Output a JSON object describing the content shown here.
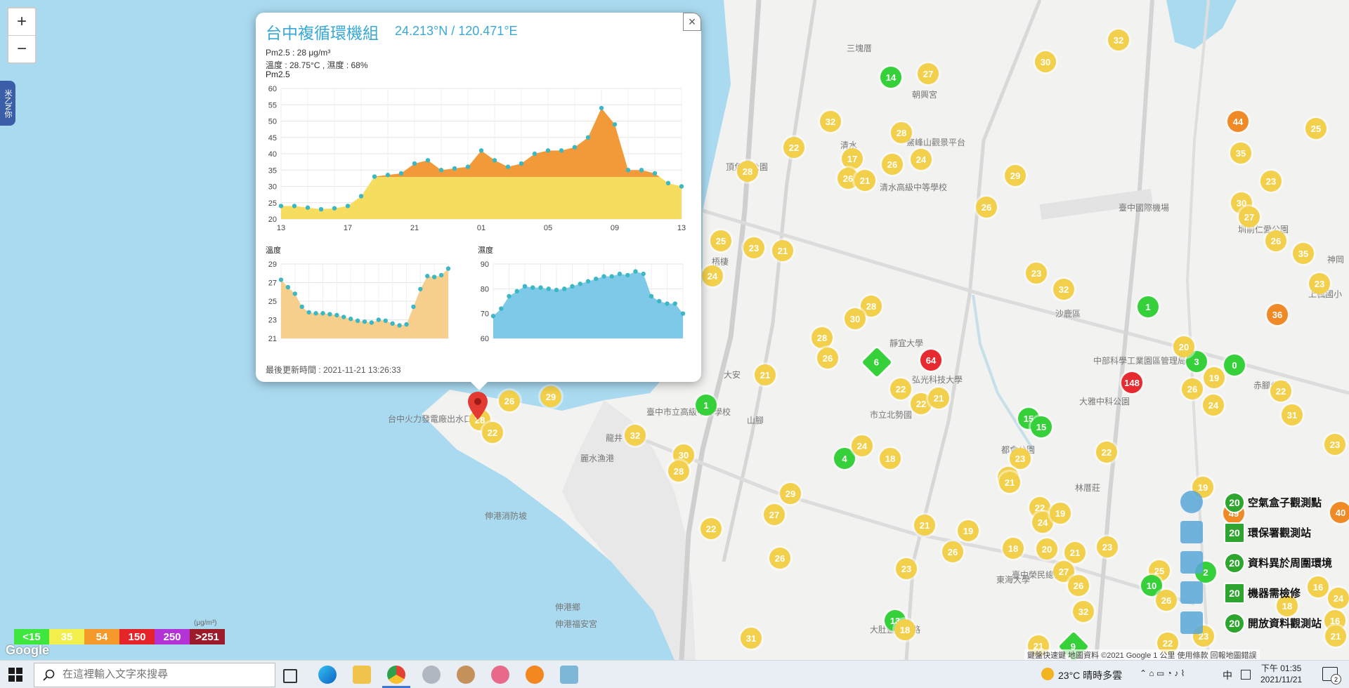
{
  "popup": {
    "title": "台中複循環機組",
    "coords": "24.213°N / 120.471°E",
    "pm_line": "Pm2.5 : 28 μg/m³",
    "temp_line": "溫度 : 28.75°C , 濕度 : 68%",
    "chart_title": "Pm2.5",
    "temp_title": "溫度",
    "hum_title": "濕度",
    "updated": "最後更新時間 : 2021-11-21 13:26:33",
    "close": "×"
  },
  "chart_data": [
    {
      "type": "area",
      "title": "Pm2.5",
      "x": [
        "13",
        "",
        "",
        "",
        "",
        "",
        "",
        "",
        "17",
        "",
        "",
        "",
        "",
        "",
        "",
        "",
        "21",
        "",
        "",
        "",
        "",
        "",
        "",
        "",
        "01",
        "",
        "",
        "",
        "",
        "",
        "",
        "",
        "05",
        "",
        "",
        "",
        "",
        "",
        "",
        "",
        "09",
        "",
        "",
        "",
        "",
        "",
        "",
        "",
        "13"
      ],
      "xticks": [
        "13",
        "17",
        "21",
        "01",
        "05",
        "09",
        "13"
      ],
      "values": [
        24,
        24,
        23.5,
        23,
        23.3,
        24,
        27,
        33,
        33.5,
        34,
        37,
        38,
        35,
        35.5,
        36,
        41,
        38,
        36,
        37,
        40,
        41,
        41,
        42,
        45,
        54,
        49,
        35,
        35,
        34,
        31,
        30
      ],
      "ylim": [
        20,
        60
      ],
      "yticks": [
        20,
        25,
        30,
        35,
        40,
        45,
        50,
        55,
        60
      ],
      "colors": [
        "#f6dd60",
        "#f29a3a"
      ]
    },
    {
      "type": "area",
      "title": "溫度",
      "values": [
        27.3,
        26.5,
        25.8,
        24.4,
        23.8,
        23.7,
        23.7,
        23.6,
        23.5,
        23.3,
        23.1,
        22.9,
        22.8,
        22.7,
        23,
        22.9,
        22.6,
        22.4,
        22.5,
        24.4,
        26.3,
        27.7,
        27.6,
        27.8,
        28.5
      ],
      "ylim": [
        21,
        29
      ],
      "yticks": [
        21,
        23,
        25,
        27,
        29
      ],
      "colors": [
        "#f7cf8c"
      ]
    },
    {
      "type": "area",
      "title": "濕度",
      "values": [
        69,
        72,
        77,
        79,
        81,
        80.5,
        80.5,
        80,
        79.5,
        80,
        81,
        82,
        83,
        84,
        85,
        85,
        86,
        85.5,
        87,
        86,
        77,
        75,
        74,
        74,
        70
      ],
      "ylim": [
        60,
        90
      ],
      "yticks": [
        60,
        70,
        80,
        90
      ],
      "colors": [
        "#7ec8e8"
      ]
    }
  ],
  "map": {
    "zoom_in": "+",
    "zoom_out": "−",
    "side_tab": "米乙N你",
    "google": "Google",
    "attribution": "鍵盤快速鍵   地圖資料 ©2021 Google   1 公里     使用條款   回報地圖錯誤",
    "places": [
      "三塊厝",
      "朝興宮",
      "清水",
      "鰲峰山觀景平台",
      "頂魚寮公園",
      "清水高級中等學校",
      "臺中國際機場",
      "圳前仁愛公園",
      "神岡",
      "上楓國小",
      "沙鹿區",
      "靜宜大學",
      "弘光科技大學",
      "市立北勢國",
      "山腳",
      "臺中市立高級中等學校",
      "龍井",
      "麗水漁港",
      "梧棲",
      "台中火力發電廠出水口",
      "伸港消防坡",
      "伸港鄉",
      "伸港福安宮",
      "大雅中科公園",
      "中部科學工業園區管理局",
      "都會公園",
      "東海大學",
      "臺中榮民總醫院",
      "赤腳公園",
      "林厝莊",
      "大肚藍色公路",
      "大安"
    ],
    "markers": [
      {
        "v": "32",
        "c": "y",
        "x": 1592,
        "y": 57
      },
      {
        "v": "30",
        "c": "y",
        "x": 1488,
        "y": 88
      },
      {
        "v": "27",
        "c": "y",
        "x": 1321,
        "y": 105
      },
      {
        "v": "14",
        "c": "g",
        "x": 1268,
        "y": 110
      },
      {
        "v": "32",
        "c": "y",
        "x": 1182,
        "y": 173
      },
      {
        "v": "28",
        "c": "y",
        "x": 1283,
        "y": 189
      },
      {
        "v": "22",
        "c": "y",
        "x": 1130,
        "y": 210
      },
      {
        "v": "17",
        "c": "y",
        "x": 1213,
        "y": 226
      },
      {
        "v": "26",
        "c": "y",
        "x": 1270,
        "y": 234
      },
      {
        "v": "24",
        "c": "y",
        "x": 1311,
        "y": 227
      },
      {
        "v": "29",
        "c": "y",
        "x": 1445,
        "y": 250
      },
      {
        "v": "28",
        "c": "y",
        "x": 1064,
        "y": 244
      },
      {
        "v": "26",
        "c": "y",
        "x": 1207,
        "y": 254
      },
      {
        "v": "21",
        "c": "y",
        "x": 1231,
        "y": 257
      },
      {
        "v": "26",
        "c": "y",
        "x": 1404,
        "y": 295
      },
      {
        "v": "25",
        "c": "y",
        "x": 1026,
        "y": 343
      },
      {
        "v": "23",
        "c": "y",
        "x": 1073,
        "y": 353
      },
      {
        "v": "21",
        "c": "y",
        "x": 1114,
        "y": 357
      },
      {
        "v": "24",
        "c": "y",
        "x": 1014,
        "y": 393
      },
      {
        "v": "23",
        "c": "y",
        "x": 1475,
        "y": 389
      },
      {
        "v": "32",
        "c": "y",
        "x": 1514,
        "y": 412
      },
      {
        "v": "28",
        "c": "y",
        "x": 1240,
        "y": 436
      },
      {
        "v": "30",
        "c": "y",
        "x": 1217,
        "y": 454
      },
      {
        "v": "28",
        "c": "y",
        "x": 1170,
        "y": 481
      },
      {
        "v": "26",
        "c": "y",
        "x": 1178,
        "y": 510
      },
      {
        "v": "6",
        "c": "g d",
        "x": 1248,
        "y": 516
      },
      {
        "v": "64",
        "c": "r",
        "x": 1325,
        "y": 513
      },
      {
        "v": "21",
        "c": "y",
        "x": 1089,
        "y": 534
      },
      {
        "v": "22",
        "c": "y",
        "x": 1282,
        "y": 554
      },
      {
        "v": "22",
        "c": "y",
        "x": 1311,
        "y": 575
      },
      {
        "v": "21",
        "c": "y",
        "x": 1336,
        "y": 567
      },
      {
        "v": "1",
        "c": "g",
        "x": 1005,
        "y": 577
      },
      {
        "v": "32",
        "c": "y",
        "x": 904,
        "y": 620
      },
      {
        "v": "30",
        "c": "y",
        "x": 973,
        "y": 648
      },
      {
        "v": "28",
        "c": "y",
        "x": 966,
        "y": 671
      },
      {
        "v": "4",
        "c": "g",
        "x": 1202,
        "y": 653
      },
      {
        "v": "24",
        "c": "y",
        "x": 1227,
        "y": 635
      },
      {
        "v": "18",
        "c": "y",
        "x": 1267,
        "y": 653
      },
      {
        "v": "15",
        "c": "g",
        "x": 1464,
        "y": 596
      },
      {
        "v": "15",
        "c": "g",
        "x": 1482,
        "y": 608
      },
      {
        "v": "23",
        "c": "y",
        "x": 1452,
        "y": 653
      },
      {
        "v": "21",
        "c": "y",
        "x": 1435,
        "y": 680
      },
      {
        "v": "21",
        "c": "y",
        "x": 1437,
        "y": 687
      },
      {
        "v": "22",
        "c": "y",
        "x": 1575,
        "y": 644
      },
      {
        "v": "29",
        "c": "y",
        "x": 1125,
        "y": 703
      },
      {
        "v": "27",
        "c": "y",
        "x": 1102,
        "y": 733
      },
      {
        "v": "22",
        "c": "y",
        "x": 1012,
        "y": 753
      },
      {
        "v": "26",
        "c": "y",
        "x": 1110,
        "y": 795
      },
      {
        "v": "21",
        "c": "y",
        "x": 1316,
        "y": 748
      },
      {
        "v": "19",
        "c": "y",
        "x": 1378,
        "y": 756
      },
      {
        "v": "26",
        "c": "y",
        "x": 1356,
        "y": 786
      },
      {
        "v": "23",
        "c": "y",
        "x": 1290,
        "y": 810
      },
      {
        "v": "18",
        "c": "y",
        "x": 1442,
        "y": 781
      },
      {
        "v": "22",
        "c": "y",
        "x": 1480,
        "y": 723
      },
      {
        "v": "24",
        "c": "y",
        "x": 1484,
        "y": 744
      },
      {
        "v": "19",
        "c": "y",
        "x": 1509,
        "y": 731
      },
      {
        "v": "20",
        "c": "y",
        "x": 1490,
        "y": 782
      },
      {
        "v": "21",
        "c": "y",
        "x": 1530,
        "y": 787
      },
      {
        "v": "23",
        "c": "y",
        "x": 1576,
        "y": 779
      },
      {
        "v": "27",
        "c": "y",
        "x": 1514,
        "y": 814
      },
      {
        "v": "26",
        "c": "y",
        "x": 1535,
        "y": 834
      },
      {
        "v": "32",
        "c": "y",
        "x": 1542,
        "y": 871
      },
      {
        "v": "13",
        "c": "g",
        "x": 1274,
        "y": 884
      },
      {
        "v": "18",
        "c": "y",
        "x": 1288,
        "y": 897
      },
      {
        "v": "31",
        "c": "y",
        "x": 1069,
        "y": 909
      },
      {
        "v": "21",
        "c": "y",
        "x": 1478,
        "y": 920
      },
      {
        "v": "9",
        "c": "g d",
        "x": 1528,
        "y": 921
      },
      {
        "v": "22",
        "c": "y",
        "x": 1662,
        "y": 916
      },
      {
        "v": "148",
        "c": "r",
        "x": 1611,
        "y": 545
      },
      {
        "v": "1",
        "c": "g",
        "x": 1634,
        "y": 437
      },
      {
        "v": "3",
        "c": "g",
        "x": 1703,
        "y": 515
      },
      {
        "v": "0",
        "c": "g",
        "x": 1757,
        "y": 520
      },
      {
        "v": "20",
        "c": "y",
        "x": 1685,
        "y": 494
      },
      {
        "v": "19",
        "c": "y",
        "x": 1728,
        "y": 538
      },
      {
        "v": "26",
        "c": "y",
        "x": 1697,
        "y": 554
      },
      {
        "v": "24",
        "c": "y",
        "x": 1727,
        "y": 577
      },
      {
        "v": "22",
        "c": "y",
        "x": 1823,
        "y": 557
      },
      {
        "v": "31",
        "c": "y",
        "x": 1839,
        "y": 591
      },
      {
        "v": "23",
        "c": "y",
        "x": 1900,
        "y": 633
      },
      {
        "v": "19",
        "c": "y",
        "x": 1712,
        "y": 694
      },
      {
        "v": "44",
        "c": "o",
        "x": 1762,
        "y": 173
      },
      {
        "v": "25",
        "c": "y",
        "x": 1873,
        "y": 183
      },
      {
        "v": "35",
        "c": "y",
        "x": 1766,
        "y": 218
      },
      {
        "v": "23",
        "c": "y",
        "x": 1809,
        "y": 258
      },
      {
        "v": "30",
        "c": "y",
        "x": 1767,
        "y": 289
      },
      {
        "v": "27",
        "c": "y",
        "x": 1778,
        "y": 309
      },
      {
        "v": "26",
        "c": "y",
        "x": 1816,
        "y": 343
      },
      {
        "v": "35",
        "c": "y",
        "x": 1855,
        "y": 361
      },
      {
        "v": "23",
        "c": "y",
        "x": 1878,
        "y": 404
      },
      {
        "v": "36",
        "c": "o",
        "x": 1818,
        "y": 448
      },
      {
        "v": "40",
        "c": "o",
        "x": 1908,
        "y": 730
      },
      {
        "v": "49",
        "c": "o",
        "x": 1756,
        "y": 731
      },
      {
        "v": "25",
        "c": "y",
        "x": 1650,
        "y": 813
      },
      {
        "v": "2",
        "c": "g",
        "x": 1716,
        "y": 815
      },
      {
        "v": "10",
        "c": "g",
        "x": 1639,
        "y": 834
      },
      {
        "v": "26",
        "c": "y",
        "x": 1660,
        "y": 855
      },
      {
        "v": "16",
        "c": "y",
        "x": 1876,
        "y": 836
      },
      {
        "v": "24",
        "c": "y",
        "x": 1905,
        "y": 852
      },
      {
        "v": "18",
        "c": "y",
        "x": 1832,
        "y": 863
      },
      {
        "v": "16",
        "c": "y",
        "x": 1900,
        "y": 884
      },
      {
        "v": "23",
        "c": "y",
        "x": 1713,
        "y": 906
      },
      {
        "v": "21",
        "c": "y",
        "x": 1901,
        "y": 906
      },
      {
        "v": "26",
        "c": "y",
        "x": 725,
        "y": 571
      },
      {
        "v": "29",
        "c": "y",
        "x": 784,
        "y": 565
      },
      {
        "v": "28",
        "c": "y",
        "x": 683,
        "y": 598
      },
      {
        "v": "22",
        "c": "y",
        "x": 701,
        "y": 616
      }
    ],
    "legend_scale": [
      {
        "label": "<15",
        "color": "#3ee63e"
      },
      {
        "label": "35",
        "color": "#f2ee4b"
      },
      {
        "label": "54",
        "color": "#f59a2a"
      },
      {
        "label": "150",
        "color": "#e5242a"
      },
      {
        "label": "250",
        "color": "#b333d6"
      },
      {
        "label": ">251",
        "color": "#9c1b2b"
      }
    ],
    "legend_unit": "(μg/m³)",
    "layer_legend": [
      {
        "num": "20",
        "label": "空氣盒子觀測點",
        "color": "#58a7d8"
      },
      {
        "num": "20",
        "label": "環保署觀測站",
        "color": "#58a7d8"
      },
      {
        "num": "20",
        "label": "資料異於周圍環境",
        "color": "#58a7d8"
      },
      {
        "num": "20",
        "label": "機器需檢修",
        "color": "#58a7d8"
      },
      {
        "num": "20",
        "label": "開放資料觀測站",
        "color": "#58a7d8"
      }
    ]
  },
  "taskbar": {
    "search_placeholder": "在這裡輸入文字來搜尋",
    "weather": "23°C  晴時多雲",
    "ime": "中",
    "time": "下午 01:35",
    "date": "2021/11/21",
    "notif_count": "2"
  }
}
